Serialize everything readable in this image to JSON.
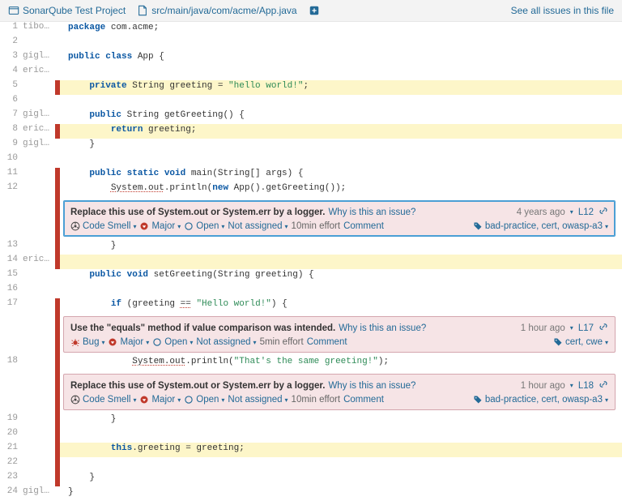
{
  "header": {
    "project_label": "SonarQube Test Project",
    "file_path": "src/main/java/com/acme/App.java",
    "see_all_label": "See all issues in this file"
  },
  "lines": [
    {
      "n": 1,
      "auth": "tibo…",
      "hl": "",
      "mark": "",
      "type": "code",
      "tokens": [
        {
          "t": "package ",
          "c": "kw"
        },
        {
          "t": "com.acme;",
          "c": "pkg"
        }
      ]
    },
    {
      "n": 2,
      "auth": "",
      "hl": "",
      "mark": "",
      "type": "code",
      "tokens": [
        {
          "t": "",
          "c": ""
        }
      ]
    },
    {
      "n": 3,
      "auth": "gigl…",
      "hl": "",
      "mark": "",
      "type": "code",
      "tokens": [
        {
          "t": "public class ",
          "c": "kw"
        },
        {
          "t": "App {",
          "c": ""
        }
      ]
    },
    {
      "n": 4,
      "auth": "eric…",
      "hl": "",
      "mark": "",
      "type": "code",
      "tokens": [
        {
          "t": "",
          "c": ""
        }
      ]
    },
    {
      "n": 5,
      "auth": "",
      "hl": "hl-yellow",
      "mark": "r",
      "type": "code",
      "tokens": [
        {
          "t": "    ",
          "c": ""
        },
        {
          "t": "private ",
          "c": "kw"
        },
        {
          "t": "String greeting = ",
          "c": ""
        },
        {
          "t": "\"hello world!\"",
          "c": "str"
        },
        {
          "t": ";",
          "c": ""
        }
      ]
    },
    {
      "n": 6,
      "auth": "",
      "hl": "",
      "mark": "",
      "type": "code",
      "tokens": [
        {
          "t": "",
          "c": ""
        }
      ]
    },
    {
      "n": 7,
      "auth": "gigl…",
      "hl": "",
      "mark": "",
      "type": "code",
      "tokens": [
        {
          "t": "    ",
          "c": ""
        },
        {
          "t": "public ",
          "c": "kw"
        },
        {
          "t": "String getGreeting() {",
          "c": ""
        }
      ]
    },
    {
      "n": 8,
      "auth": "eric…",
      "hl": "hl-yellow",
      "mark": "r",
      "type": "code",
      "tokens": [
        {
          "t": "        ",
          "c": ""
        },
        {
          "t": "return ",
          "c": "kw"
        },
        {
          "t": "greeting;",
          "c": ""
        }
      ]
    },
    {
      "n": 9,
      "auth": "gigl…",
      "hl": "",
      "mark": "",
      "type": "code",
      "tokens": [
        {
          "t": "    }",
          "c": ""
        }
      ]
    },
    {
      "n": 10,
      "auth": "",
      "hl": "",
      "mark": "",
      "type": "code",
      "tokens": [
        {
          "t": "",
          "c": ""
        }
      ]
    },
    {
      "n": 11,
      "auth": "",
      "hl": "",
      "mark": "r",
      "type": "code",
      "tokens": [
        {
          "t": "    ",
          "c": ""
        },
        {
          "t": "public static void ",
          "c": "kw"
        },
        {
          "t": "main(String[] args) {",
          "c": ""
        }
      ]
    },
    {
      "n": 12,
      "auth": "",
      "hl": "",
      "mark": "r",
      "type": "code",
      "tokens": [
        {
          "t": "        ",
          "c": ""
        },
        {
          "t": "System.out",
          "c": "sysout"
        },
        {
          "t": ".println(",
          "c": ""
        },
        {
          "t": "new ",
          "c": "kw"
        },
        {
          "t": "App().getGreeting());",
          "c": ""
        }
      ]
    },
    {
      "n": 0,
      "auth": "",
      "hl": "",
      "mark": "r",
      "type": "issue",
      "issue": 0
    },
    {
      "n": 13,
      "auth": "",
      "hl": "",
      "mark": "r",
      "type": "code",
      "tokens": [
        {
          "t": "        }",
          "c": ""
        }
      ]
    },
    {
      "n": 14,
      "auth": "eric…",
      "hl": "hl-yellow",
      "mark": "",
      "type": "code",
      "tokens": [
        {
          "t": "",
          "c": ""
        }
      ]
    },
    {
      "n": 15,
      "auth": "",
      "hl": "",
      "mark": "",
      "type": "code",
      "tokens": [
        {
          "t": "    ",
          "c": ""
        },
        {
          "t": "public void ",
          "c": "kw"
        },
        {
          "t": "setGreeting(String greeting) {",
          "c": ""
        }
      ]
    },
    {
      "n": 16,
      "auth": "",
      "hl": "",
      "mark": "",
      "type": "code",
      "tokens": [
        {
          "t": "",
          "c": ""
        }
      ]
    },
    {
      "n": 17,
      "auth": "",
      "hl": "",
      "mark": "r",
      "type": "code",
      "tokens": [
        {
          "t": "        ",
          "c": ""
        },
        {
          "t": "if ",
          "c": "kw"
        },
        {
          "t": "(greeting ",
          "c": ""
        },
        {
          "t": "==",
          "c": "sysout"
        },
        {
          "t": " ",
          "c": ""
        },
        {
          "t": "\"Hello world!\"",
          "c": "str"
        },
        {
          "t": ") {",
          "c": ""
        }
      ]
    },
    {
      "n": 0,
      "auth": "",
      "hl": "",
      "mark": "r",
      "type": "issue",
      "issue": 1
    },
    {
      "n": 18,
      "auth": "",
      "hl": "",
      "mark": "r",
      "type": "code",
      "tokens": [
        {
          "t": "            ",
          "c": ""
        },
        {
          "t": "System.out",
          "c": "sysout"
        },
        {
          "t": ".println(",
          "c": ""
        },
        {
          "t": "\"That's the same greeting!\"",
          "c": "str"
        },
        {
          "t": ");",
          "c": ""
        }
      ]
    },
    {
      "n": 0,
      "auth": "",
      "hl": "",
      "mark": "r",
      "type": "issue",
      "issue": 2
    },
    {
      "n": 19,
      "auth": "",
      "hl": "",
      "mark": "r",
      "type": "code",
      "tokens": [
        {
          "t": "        }",
          "c": ""
        }
      ]
    },
    {
      "n": 20,
      "auth": "",
      "hl": "",
      "mark": "r",
      "type": "code",
      "tokens": [
        {
          "t": "",
          "c": ""
        }
      ]
    },
    {
      "n": 21,
      "auth": "",
      "hl": "hl-yellow",
      "mark": "r",
      "type": "code",
      "tokens": [
        {
          "t": "        ",
          "c": ""
        },
        {
          "t": "this",
          "c": "kw"
        },
        {
          "t": ".greeting = greeting;",
          "c": ""
        }
      ]
    },
    {
      "n": 22,
      "auth": "",
      "hl": "",
      "mark": "r",
      "type": "code",
      "tokens": [
        {
          "t": "",
          "c": ""
        }
      ]
    },
    {
      "n": 23,
      "auth": "",
      "hl": "",
      "mark": "r",
      "type": "code",
      "tokens": [
        {
          "t": "    }",
          "c": ""
        }
      ]
    },
    {
      "n": 24,
      "auth": "gigl…",
      "hl": "",
      "mark": "",
      "type": "code",
      "tokens": [
        {
          "t": "}",
          "c": ""
        }
      ]
    }
  ],
  "issues": [
    {
      "selected": true,
      "message": "Replace this use of System.out or System.err by a logger.",
      "why_label": "Why is this an issue?",
      "type_label": "Code Smell",
      "type_icon": "codesmell",
      "severity_label": "Major",
      "status_label": "Open",
      "assignee_label": "Not assigned",
      "effort_label": "10min effort",
      "comment_label": "Comment",
      "age_label": "4 years ago",
      "line_label": "L12",
      "tags_label": "bad-practice, cert, owasp-a3"
    },
    {
      "selected": false,
      "message": "Use the \"equals\" method if value comparison was intended.",
      "why_label": "Why is this an issue?",
      "type_label": "Bug",
      "type_icon": "bug",
      "severity_label": "Major",
      "status_label": "Open",
      "assignee_label": "Not assigned",
      "effort_label": "5min effort",
      "comment_label": "Comment",
      "age_label": "1 hour ago",
      "line_label": "L17",
      "tags_label": "cert, cwe"
    },
    {
      "selected": false,
      "message": "Replace this use of System.out or System.err by a logger.",
      "why_label": "Why is this an issue?",
      "type_label": "Code Smell",
      "type_icon": "codesmell",
      "severity_label": "Major",
      "status_label": "Open",
      "assignee_label": "Not assigned",
      "effort_label": "10min effort",
      "comment_label": "Comment",
      "age_label": "1 hour ago",
      "line_label": "L18",
      "tags_label": "bad-practice, cert, owasp-a3"
    }
  ],
  "icons": {
    "dropdown_tri": "▾"
  }
}
